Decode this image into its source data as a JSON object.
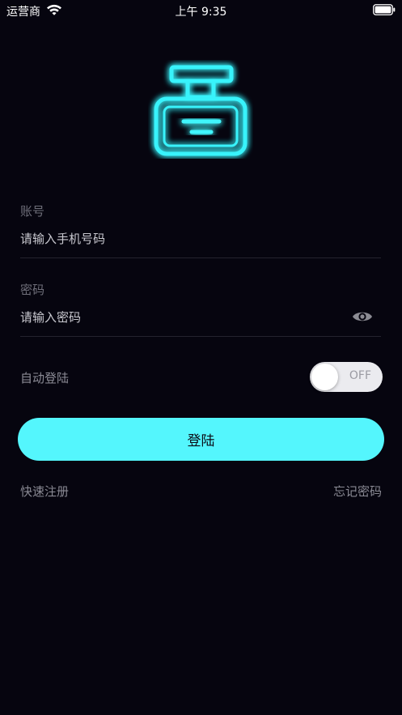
{
  "status_bar": {
    "carrier": "运营商",
    "time": "上午 9:35"
  },
  "account": {
    "label": "账号",
    "placeholder": "请输入手机号码",
    "value": ""
  },
  "password": {
    "label": "密码",
    "placeholder": "请输入密码",
    "value": ""
  },
  "auto_login": {
    "label": "自动登陆",
    "toggle_text": "OFF",
    "enabled": false
  },
  "login_button": "登陆",
  "links": {
    "register": "快速注册",
    "forgot_password": "忘记密码"
  },
  "colors": {
    "background": "#06050f",
    "accent": "#54f6fd"
  },
  "icons": {
    "logo": "printer-icon",
    "password_visibility": "eye-icon",
    "signal": "wifi-icon",
    "power": "battery-icon"
  }
}
